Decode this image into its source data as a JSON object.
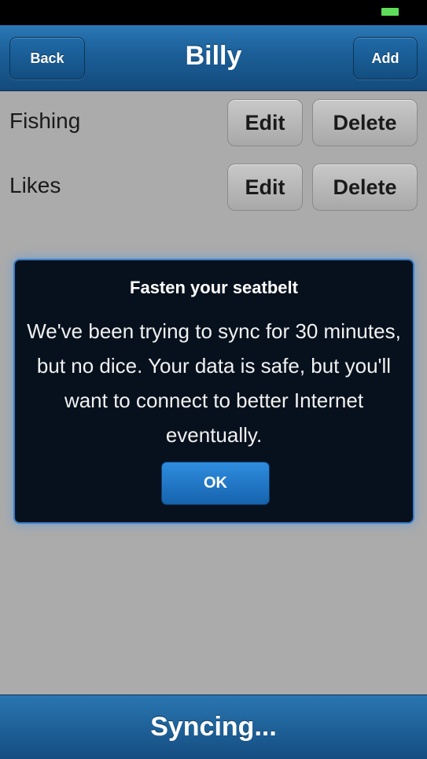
{
  "status_bar": {
    "battery_color": "#5fdc5a"
  },
  "nav": {
    "title": "Billy",
    "back_label": "Back",
    "add_label": "Add"
  },
  "list": {
    "items": [
      {
        "label": "Fishing",
        "edit_label": "Edit",
        "delete_label": "Delete"
      },
      {
        "label": "Likes",
        "edit_label": "Edit",
        "delete_label": "Delete"
      }
    ]
  },
  "alert": {
    "title": "Fasten your seatbelt",
    "message": "We've been trying to sync for 30 minutes, but no dice. Your data is safe, but you'll want to connect to better Internet eventually.",
    "ok_label": "OK"
  },
  "bottom_bar": {
    "status_text": "Syncing..."
  },
  "colors": {
    "accent": "#1b5e97",
    "alert_border": "#3c7fc9"
  }
}
